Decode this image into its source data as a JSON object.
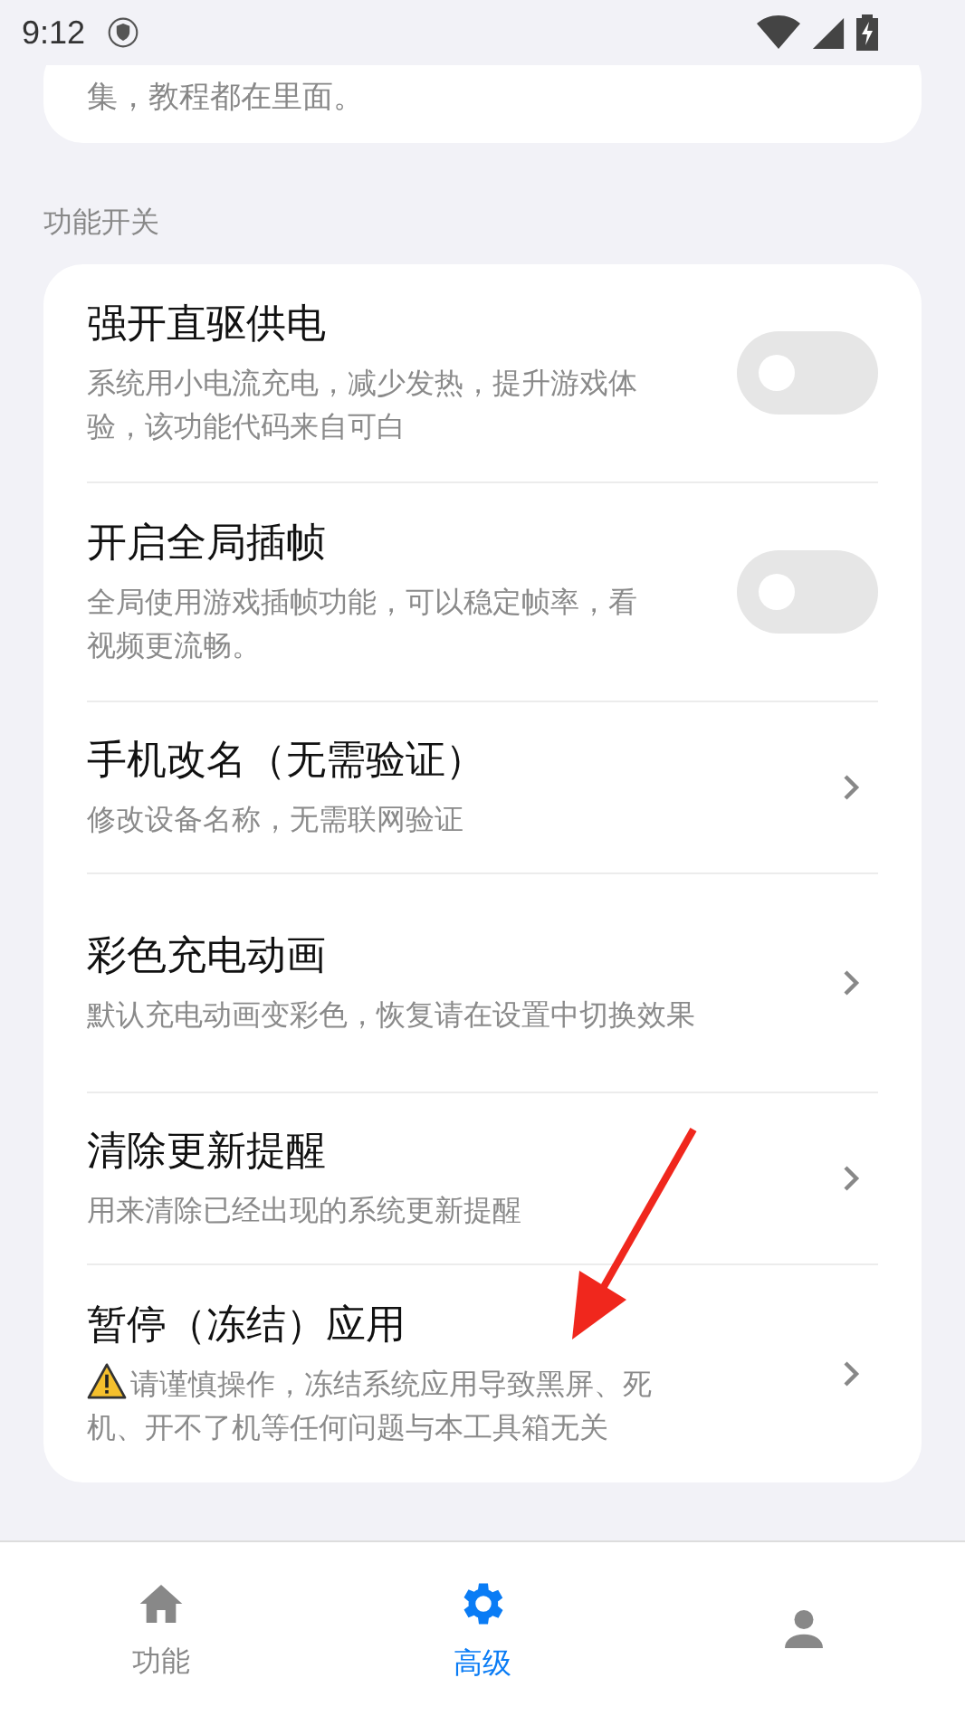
{
  "status_bar": {
    "time": "9:12"
  },
  "intro_card": {
    "text": "集，教程都在里面。"
  },
  "section": {
    "title": "功能开关"
  },
  "items": [
    {
      "kind": "toggle",
      "title": "强开直驱供电",
      "desc": "系统用小电流充电，减少发热，提升游戏体验，该功能代码来自可白",
      "on": false
    },
    {
      "kind": "toggle",
      "title": "开启全局插帧",
      "desc": "全局使用游戏插帧功能，可以稳定帧率，看视频更流畅。",
      "on": false
    },
    {
      "kind": "link",
      "title": "手机改名（无需验证）",
      "desc": "修改设备名称，无需联网验证"
    },
    {
      "kind": "link",
      "title": "彩色充电动画",
      "desc": "默认充电动画变彩色，恢复请在设置中切换效果"
    },
    {
      "kind": "link",
      "title": "清除更新提醒",
      "desc": "用来清除已经出现的系统更新提醒"
    },
    {
      "kind": "link",
      "title": "暂停（冻结）应用",
      "desc": "请谨慎操作，冻结系统应用导致黑屏、死机、开不了机等任何问题与本工具箱无关",
      "warning": true
    }
  ],
  "nav": [
    {
      "kind": "home",
      "label": "功能",
      "selected": false
    },
    {
      "kind": "settings",
      "label": "高级",
      "selected": true
    },
    {
      "kind": "person",
      "selected": false
    }
  ]
}
